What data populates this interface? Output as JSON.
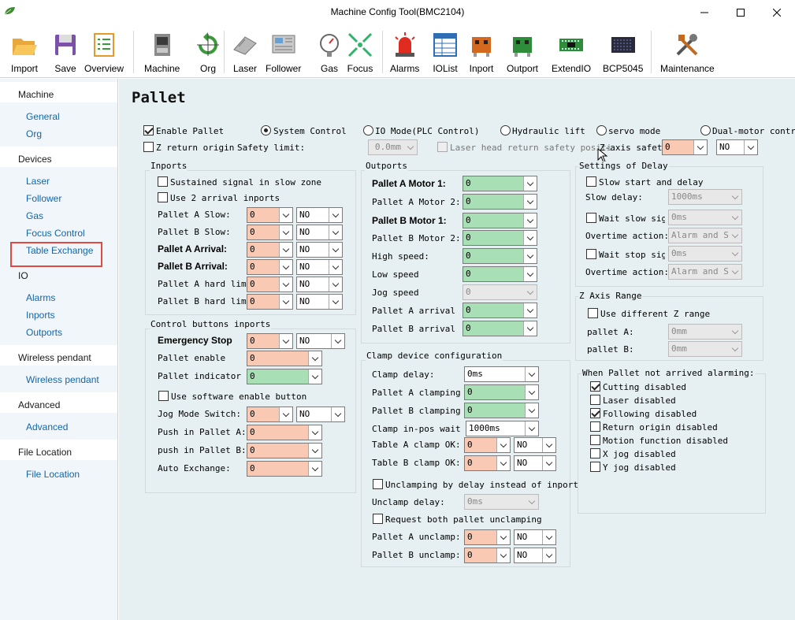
{
  "window": {
    "title": "Machine Config Tool(BMC2104)"
  },
  "toolbar": {
    "import": "Import",
    "save": "Save",
    "overview": "Overview",
    "machine": "Machine",
    "org": "Org",
    "laser": "Laser",
    "follower": "Follower",
    "gas": "Gas",
    "focus": "Focus",
    "alarms": "Alarms",
    "iolist": "IOList",
    "inport": "Inport",
    "outport": "Outport",
    "extendio": "ExtendIO",
    "bcp5045": "BCP5045",
    "maintenance": "Maintenance"
  },
  "sidebar": {
    "machine": "Machine",
    "general": "General",
    "org": "Org",
    "devices": "Devices",
    "laser": "Laser",
    "follower": "Follower",
    "gas": "Gas",
    "focus_control": "Focus Control",
    "table_exchange": "Table Exchange",
    "io": "IO",
    "alarms": "Alarms",
    "inports": "Inports",
    "outports": "Outports",
    "wireless_pendant_h": "Wireless pendant",
    "wireless_pendant": "Wireless pendant",
    "advanced_h": "Advanced",
    "advanced": "Advanced",
    "file_location_h": "File Location",
    "file_location": "File Location"
  },
  "page": {
    "title": "Pallet"
  },
  "top": {
    "enable_pallet": "Enable Pallet",
    "system_control": "System Control",
    "io_mode": "IO Mode(PLC Control)",
    "hydraulic_lift": "Hydraulic lift",
    "servo_mode": "servo mode",
    "dual_motor": "Dual-motor control",
    "z_return": "Z return origin",
    "safety_limit": "Safety limit:",
    "safety_limit_val": "0.0mm",
    "laser_head_return": "Laser head return safety positi",
    "z_axis_safety": "Z-axis safety",
    "z_axis_val": "0",
    "z_axis_level": "NO"
  },
  "inports": {
    "title": "Inports",
    "sustained": "Sustained signal in slow zone",
    "use2": "Use 2 arrival inports",
    "rows": [
      {
        "label": "Pallet A Slow:",
        "v": "0",
        "lv": "NO"
      },
      {
        "label": "Pallet B Slow:",
        "v": "0",
        "lv": "NO"
      },
      {
        "label": "Pallet A Arrival:",
        "v": "0",
        "lv": "NO"
      },
      {
        "label": "Pallet B Arrival:",
        "v": "0",
        "lv": "NO"
      },
      {
        "label": "Pallet A hard limit",
        "v": "0",
        "lv": "NO"
      },
      {
        "label": "Pallet B hard limit",
        "v": "0",
        "lv": "NO"
      }
    ]
  },
  "control": {
    "title": "Control buttons inports",
    "estop": "Emergency Stop",
    "estop_v": "0",
    "estop_lv": "NO",
    "enable": "Pallet enable",
    "enable_v": "0",
    "indicator": "Pallet indicator",
    "indicator_v": "0",
    "software": "Use software enable button",
    "jog": "Jog Mode Switch:",
    "jog_v": "0",
    "jog_lv": "NO",
    "push_a": "Push in Pallet A:",
    "push_a_v": "0",
    "push_b": "push in Pallet B:",
    "push_b_v": "0",
    "auto": "Auto Exchange:",
    "auto_v": "0"
  },
  "outports": {
    "title": "Outports",
    "rows": [
      {
        "label": "Pallet A Motor 1:",
        "v": "0"
      },
      {
        "label": "Pallet A Motor 2:",
        "v": "0"
      },
      {
        "label": "Pallet B Motor 1:",
        "v": "0"
      },
      {
        "label": "Pallet B Motor 2:",
        "v": "0"
      },
      {
        "label": "High speed:",
        "v": "0"
      },
      {
        "label": "Low speed",
        "v": "0"
      },
      {
        "label": "Jog speed",
        "v": "0"
      },
      {
        "label": "Pallet A arrival",
        "v": "0"
      },
      {
        "label": "Pallet B arrival",
        "v": "0"
      }
    ]
  },
  "clamp": {
    "title": "Clamp device configuration",
    "delay": "Clamp delay:",
    "delay_v": "0ms",
    "a_clamping": "Pallet A clamping",
    "a_clamping_v": "0",
    "b_clamping": "Pallet B clamping",
    "b_clamping_v": "0",
    "inpos": "Clamp in-pos wait de",
    "inpos_v": "1000ms",
    "a_ok": "Table A clamp OK:",
    "a_ok_v": "0",
    "a_ok_lv": "NO",
    "b_ok": "Table B clamp OK:",
    "b_ok_v": "0",
    "b_ok_lv": "NO",
    "by_delay": "Unclamping by delay instead of inport",
    "unclamp_delay": "Unclamp delay:",
    "unclamp_delay_v": "0ms",
    "request_both": "Request both pallet unclamping",
    "a_unclamp": "Pallet A unclamp:",
    "a_unclamp_v": "0",
    "a_unclamp_lv": "NO",
    "b_unclamp": "Pallet B unclamp:",
    "b_unclamp_v": "0",
    "b_unclamp_lv": "NO"
  },
  "delay": {
    "title": "Settings of Delay",
    "slow_start": "Slow start and delay",
    "slow_delay": "Slow delay:",
    "slow_delay_v": "1000ms",
    "wait_slow": "Wait slow sign",
    "wait_slow_v": "0ms",
    "overtime1": "Overtime action:",
    "overtime1_v": "Alarm and St",
    "wait_stop": "Wait stop signa",
    "wait_stop_v": "0ms",
    "overtime2": "Overtime action:",
    "overtime2_v": "Alarm and St"
  },
  "zaxis": {
    "title": "Z Axis Range",
    "use_diff": "Use different Z range",
    "pa": "pallet A:",
    "pa_v": "0mm",
    "pb": "pallet B:",
    "pb_v": "0mm"
  },
  "alarm": {
    "title": "When Pallet not arrived alarming:",
    "items": [
      "Cutting disabled",
      "Laser disabled",
      "Following disabled",
      "Return origin disabled",
      "Motion function disabled",
      "X jog disabled",
      "Y jog disabled"
    ]
  }
}
